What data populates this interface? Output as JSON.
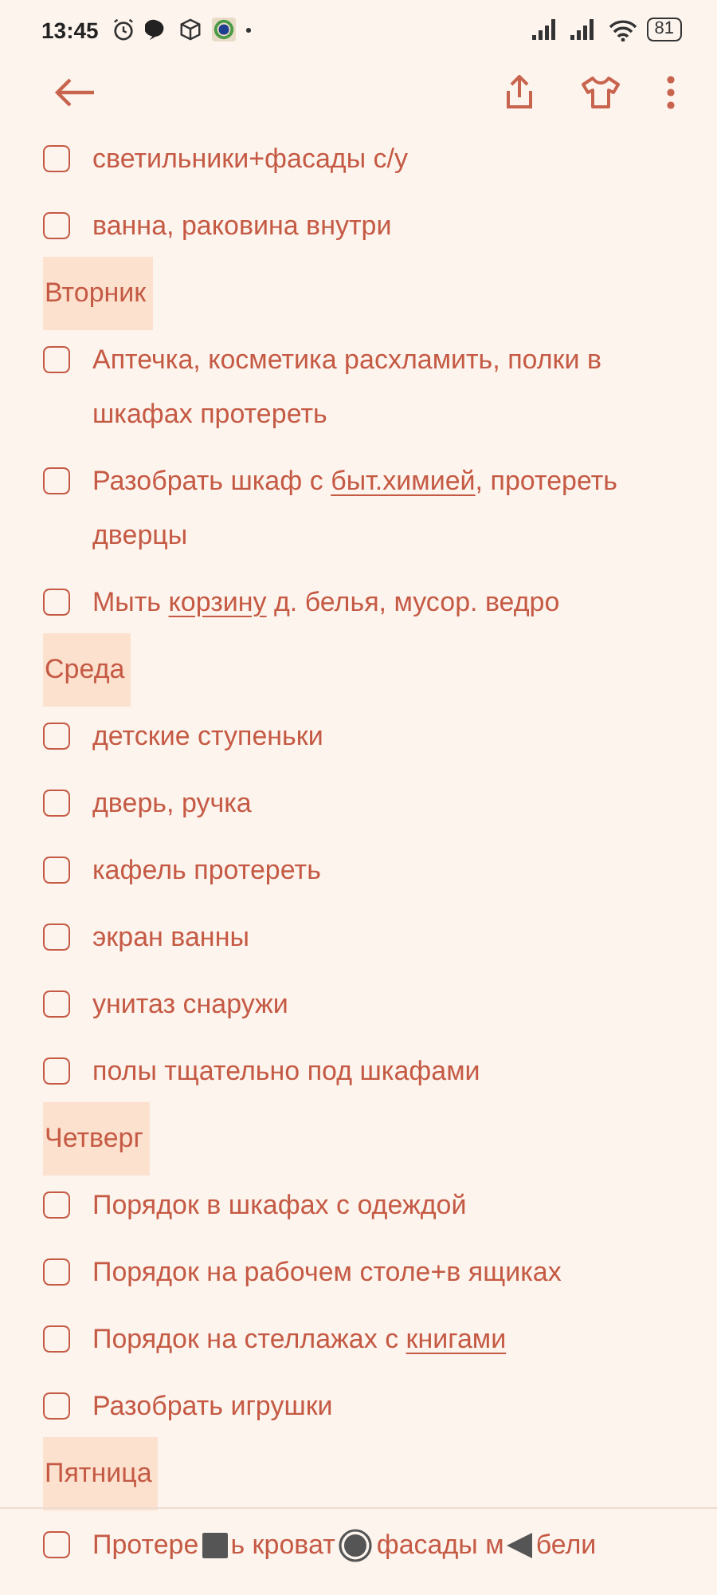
{
  "status_bar": {
    "time": "13:45",
    "battery": "81"
  },
  "list": [
    {
      "kind": "task",
      "checked": false,
      "parts": [
        {
          "text": "светильники+фасады с/у",
          "link": false
        }
      ]
    },
    {
      "kind": "task",
      "checked": false,
      "parts": [
        {
          "text": "ванна, раковина внутри",
          "link": false
        }
      ]
    },
    {
      "kind": "heading",
      "text": "Вторник"
    },
    {
      "kind": "task",
      "checked": false,
      "parts": [
        {
          "text": "Аптечка, косметика расхламить, полки в шкафах протереть",
          "link": false
        }
      ]
    },
    {
      "kind": "task",
      "checked": false,
      "parts": [
        {
          "text": "Разобрать шкаф с ",
          "link": false
        },
        {
          "text": "быт.химией",
          "link": true
        },
        {
          "text": ", протереть дверцы",
          "link": false
        }
      ]
    },
    {
      "kind": "task",
      "checked": false,
      "parts": [
        {
          "text": "Мыть ",
          "link": false
        },
        {
          "text": "корзину",
          "link": true
        },
        {
          "text": " д. белья, мусор. ведро",
          "link": false
        }
      ]
    },
    {
      "kind": "heading",
      "text": "Среда"
    },
    {
      "kind": "task",
      "checked": false,
      "parts": [
        {
          "text": "детские ступеньки",
          "link": false
        }
      ]
    },
    {
      "kind": "task",
      "checked": false,
      "parts": [
        {
          "text": "дверь, ручка",
          "link": false
        }
      ]
    },
    {
      "kind": "task",
      "checked": false,
      "parts": [
        {
          "text": "кафель протереть",
          "link": false
        }
      ]
    },
    {
      "kind": "task",
      "checked": false,
      "parts": [
        {
          "text": "экран ванны",
          "link": false
        }
      ]
    },
    {
      "kind": "task",
      "checked": false,
      "parts": [
        {
          "text": "унитаз снаружи",
          "link": false
        }
      ]
    },
    {
      "kind": "task",
      "checked": false,
      "parts": [
        {
          "text": "полы тщательно под шкафами",
          "link": false
        }
      ]
    },
    {
      "kind": "heading",
      "text": "Четверг"
    },
    {
      "kind": "task",
      "checked": false,
      "parts": [
        {
          "text": "Порядок в шкафах с одеждой",
          "link": false
        }
      ]
    },
    {
      "kind": "task",
      "checked": false,
      "parts": [
        {
          "text": "Порядок на рабочем столе+в ящиках",
          "link": false
        }
      ]
    },
    {
      "kind": "task",
      "checked": false,
      "parts": [
        {
          "text": "Порядок на стеллажах с ",
          "link": false
        },
        {
          "text": "книгами",
          "link": true
        }
      ]
    },
    {
      "kind": "task",
      "checked": false,
      "parts": [
        {
          "text": "Разобрать игрушки",
          "link": false
        }
      ]
    },
    {
      "kind": "heading",
      "text": "Пятница"
    }
  ],
  "bottom_item": {
    "kind": "task",
    "checked": false,
    "fragments": [
      "Протере",
      "ь кроват",
      "фасады м",
      "бели"
    ]
  }
}
